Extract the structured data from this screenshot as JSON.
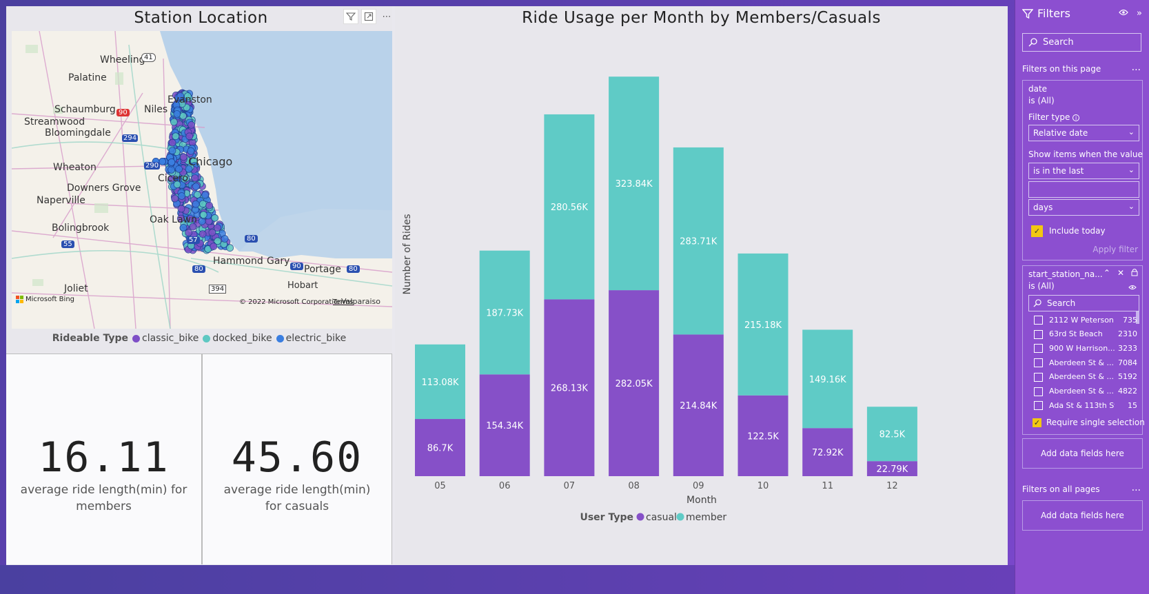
{
  "map": {
    "title": "Station Location",
    "icons": [
      "filter-icon",
      "focus-mode-icon",
      "more-options-icon"
    ],
    "labels": [
      {
        "text": "Wheeling"
      },
      {
        "text": "Palatine"
      },
      {
        "text": "Schaumburg"
      },
      {
        "text": "Niles"
      },
      {
        "text": "Evanston"
      },
      {
        "text": "Streamwood"
      },
      {
        "text": "Bloomingdale"
      },
      {
        "text": "Wheaton"
      },
      {
        "text": "Chicago"
      },
      {
        "text": "Cicero"
      },
      {
        "text": "Downers Grove"
      },
      {
        "text": "Naperville"
      },
      {
        "text": "Oak Lawn"
      },
      {
        "text": "Bolingbrook"
      },
      {
        "text": "Hammond"
      },
      {
        "text": "Gary"
      },
      {
        "text": "Portage"
      },
      {
        "text": "Joliet"
      },
      {
        "text": "Hobart"
      },
      {
        "text": "Valparaiso"
      }
    ],
    "highway_shields": [
      "41",
      "90",
      "294",
      "290",
      "55",
      "57",
      "80",
      "90",
      "80",
      "80",
      "394"
    ],
    "bing_logo": "Microsoft Bing",
    "copyright": "© 2022 Microsoft Corporation",
    "terms": "Terms",
    "legend": {
      "title": "Rideable Type",
      "items": [
        {
          "label": "classic_bike",
          "color": "#7e4fc7"
        },
        {
          "label": "docked_bike",
          "color": "#5ec8c2"
        },
        {
          "label": "electric_bike",
          "color": "#3a7ee0"
        }
      ]
    }
  },
  "cards": [
    {
      "value": "16.11",
      "label": "average ride length(min) for members"
    },
    {
      "value": "45.60",
      "label": "average ride length(min) for casuals"
    }
  ],
  "chart_data": {
    "type": "bar",
    "stacked": true,
    "title": "Ride Usage per Month by Members/Casuals",
    "xlabel": "Month",
    "ylabel": "Number of Rides",
    "categories": [
      "05",
      "06",
      "07",
      "08",
      "09",
      "10",
      "11",
      "12"
    ],
    "series": [
      {
        "name": "casual",
        "color": "#8650c8",
        "values": [
          86700,
          154340,
          268130,
          282050,
          214840,
          122500,
          72920,
          22790
        ],
        "labels": [
          "86.7K",
          "154.34K",
          "268.13K",
          "282.05K",
          "214.84K",
          "122.5K",
          "72.92K",
          "22.79K"
        ]
      },
      {
        "name": "member",
        "color": "#5fcbc6",
        "values": [
          113080,
          187730,
          280560,
          323840,
          283710,
          215180,
          149160,
          82500
        ],
        "labels": [
          "113.08K",
          "187.73K",
          "280.56K",
          "323.84K",
          "283.71K",
          "215.18K",
          "149.16K",
          "82.5K"
        ]
      }
    ],
    "ylim": [
      0,
      650000
    ],
    "gridlines": false,
    "legend": {
      "title": "User Type",
      "placement": "bottom"
    }
  },
  "filters": {
    "title": "Filters",
    "search_placeholder": "Search",
    "on_this_page": "Filters on this page",
    "date_card": {
      "field": "date",
      "state": "is (All)",
      "filter_type_label": "Filter type",
      "filter_type_value": "Relative date",
      "show_items_label": "Show items when the value",
      "operator_value": "is in the last",
      "amount_value": "",
      "unit_value": "days",
      "include_today": "Include today",
      "apply": "Apply filter"
    },
    "station_card": {
      "field": "start_station_na...",
      "state": "is (All)",
      "search_placeholder": "Search",
      "items": [
        {
          "name": "2112 W Peterson...",
          "count": "735"
        },
        {
          "name": "63rd St Beach",
          "count": "2310"
        },
        {
          "name": "900 W Harrison...",
          "count": "3233"
        },
        {
          "name": "Aberdeen St & ...",
          "count": "7084"
        },
        {
          "name": "Aberdeen St & ...",
          "count": "5192"
        },
        {
          "name": "Aberdeen St & ...",
          "count": "4822"
        },
        {
          "name": "Ada St & 113th St",
          "count": "15"
        }
      ],
      "require_single": "Require single selection"
    },
    "add_fields": "Add data fields here",
    "on_all_pages": "Filters on all pages",
    "add_fields_all": "Add data fields here",
    "more": "..."
  }
}
